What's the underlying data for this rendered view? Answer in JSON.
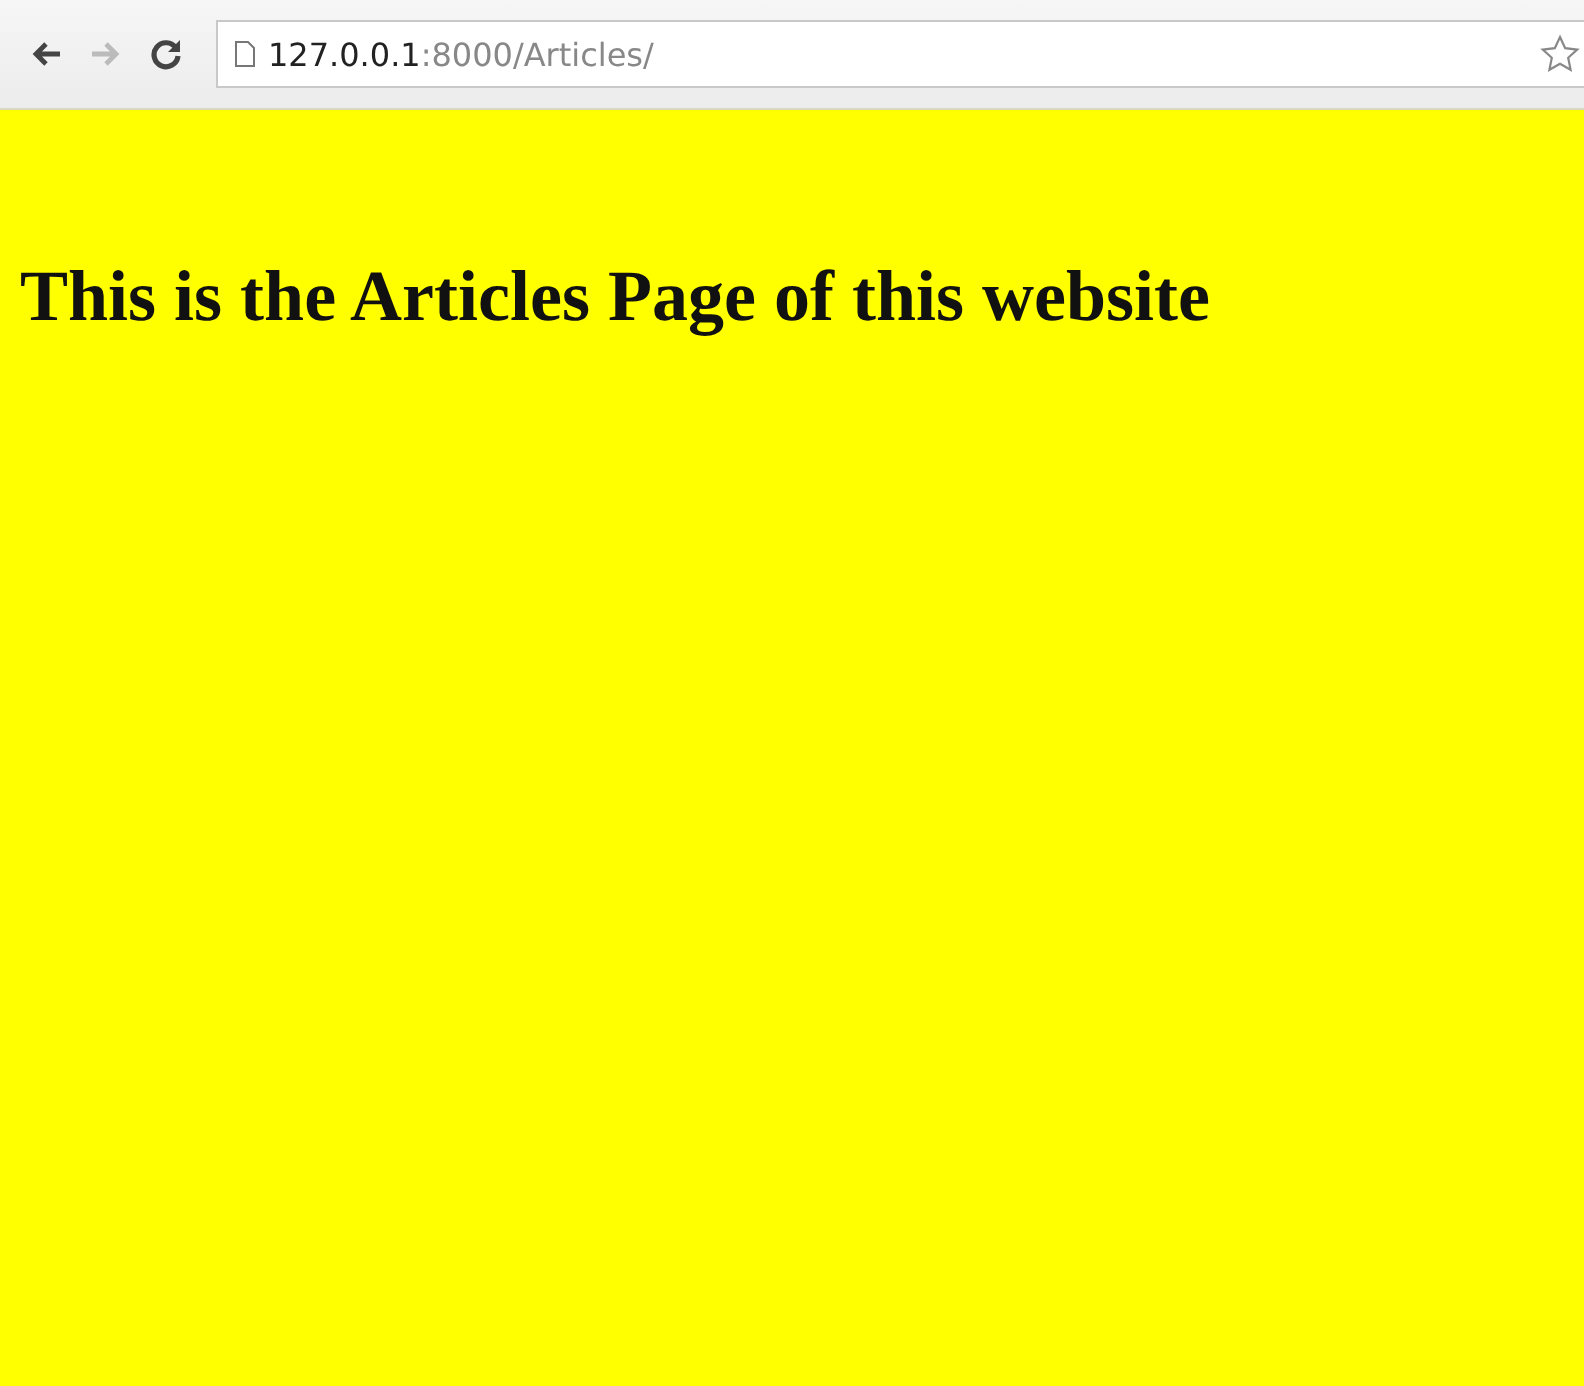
{
  "toolbar": {
    "nav_buttons": [
      {
        "kind": "back",
        "disabled": false
      },
      {
        "kind": "forward",
        "disabled": true
      },
      {
        "kind": "reload",
        "disabled": false
      }
    ],
    "address": {
      "host": "127.0.0.1",
      "rest": ":8000/Articles/"
    }
  },
  "page": {
    "heading": "This is the Articles Page of this website"
  }
}
